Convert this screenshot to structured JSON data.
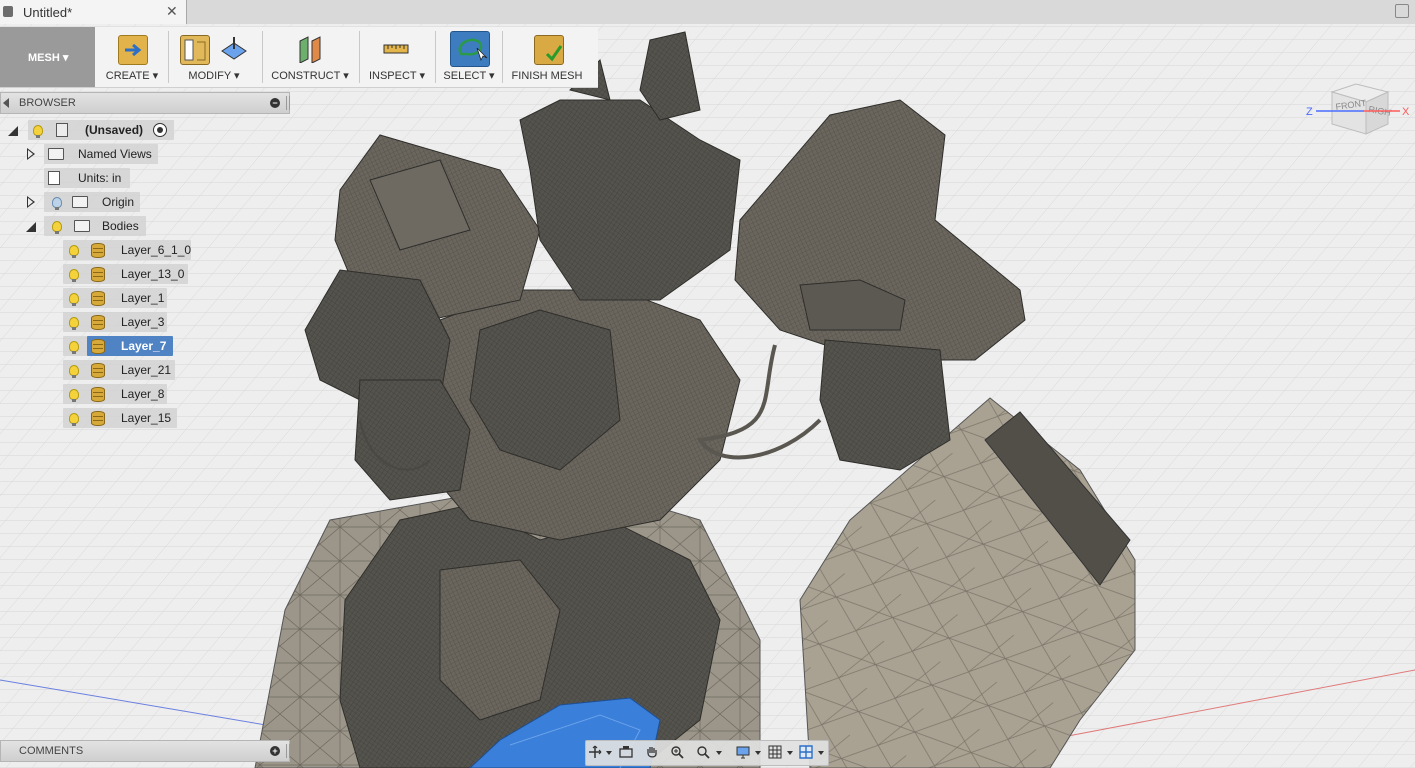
{
  "tab": {
    "title": "Untitled*",
    "close": "✕"
  },
  "toolbar": {
    "workspace": "MESH ▾",
    "groups": [
      {
        "label": "CREATE ▾"
      },
      {
        "label": "MODIFY ▾"
      },
      {
        "label": "CONSTRUCT ▾"
      },
      {
        "label": "INSPECT ▾"
      },
      {
        "label": "SELECT ▾"
      },
      {
        "label": "FINISH MESH"
      }
    ]
  },
  "browser": {
    "title": "BROWSER",
    "root": "(Unsaved)",
    "named_views": "Named Views",
    "units": "Units: in",
    "origin": "Origin",
    "bodies": "Bodies",
    "layers": [
      {
        "label": "Layer_6_1_0",
        "selected": false
      },
      {
        "label": "Layer_13_0",
        "selected": false
      },
      {
        "label": "Layer_1",
        "selected": false
      },
      {
        "label": "Layer_3",
        "selected": false
      },
      {
        "label": "Layer_7",
        "selected": true
      },
      {
        "label": "Layer_21",
        "selected": false
      },
      {
        "label": "Layer_8",
        "selected": false
      },
      {
        "label": "Layer_15",
        "selected": false
      }
    ]
  },
  "comments": {
    "title": "COMMENTS"
  },
  "viewcube": {
    "front": "FRONT",
    "right": "RIGHT",
    "axis_x": "X",
    "axis_z": "Z"
  },
  "colors": {
    "selection": "#4f83c4",
    "mesh_dark": "#4a4944",
    "mesh_light": "#8e887c",
    "accent_blue": "#3a7fd9"
  }
}
